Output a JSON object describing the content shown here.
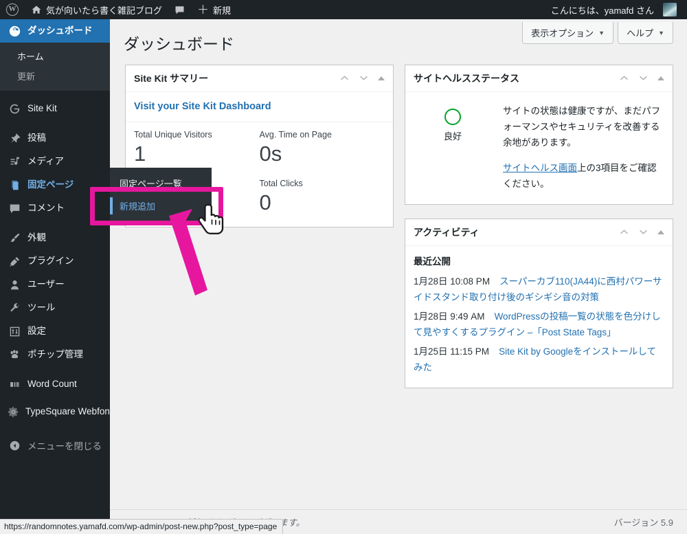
{
  "adminbar": {
    "wp_logo_label": "W",
    "site_name": "気が向いたら書く雑記ブログ",
    "comments_icon": "comment-bubble-icon",
    "new_label": "新規",
    "greeting": "こんにちは、yamafd さん"
  },
  "sidebar": {
    "items": [
      {
        "label": "ダッシュボード",
        "icon": "dashboard-icon",
        "state": "current"
      },
      {
        "label": "Site Kit",
        "icon": "google-g-icon",
        "state": "normal"
      },
      {
        "label": "投稿",
        "icon": "pin-icon",
        "state": "normal"
      },
      {
        "label": "メディア",
        "icon": "media-icon",
        "state": "normal"
      },
      {
        "label": "固定ページ",
        "icon": "pages-icon",
        "state": "open-parent"
      },
      {
        "label": "コメント",
        "icon": "comment-icon",
        "state": "normal"
      },
      {
        "label": "外観",
        "icon": "appearance-brush-icon",
        "state": "normal"
      },
      {
        "label": "プラグイン",
        "icon": "plugin-icon",
        "state": "normal"
      },
      {
        "label": "ユーザー",
        "icon": "user-icon",
        "state": "normal"
      },
      {
        "label": "ツール",
        "icon": "wrench-icon",
        "state": "normal"
      },
      {
        "label": "設定",
        "icon": "settings-sliders-icon",
        "state": "normal"
      },
      {
        "label": "ポチップ管理",
        "icon": "paw-icon",
        "state": "normal"
      },
      {
        "label": "Word Count",
        "icon": "wordcount-icon",
        "state": "normal"
      },
      {
        "label": "TypeSquare Webfonts",
        "icon": "gear-icon",
        "state": "normal"
      }
    ],
    "dashboard_submenu": [
      {
        "label": "ホーム",
        "dim": false
      },
      {
        "label": "更新",
        "dim": true
      }
    ],
    "collapse_label": "メニューを閉じる",
    "collapse_icon": "collapse-arrow-icon"
  },
  "pages_flyout": {
    "items": [
      {
        "label": "固定ページ一覧",
        "active": false
      },
      {
        "label": "新規追加",
        "active": true
      }
    ]
  },
  "screen_meta": {
    "screen_options_label": "表示オプション",
    "help_label": "ヘルプ",
    "caret_icon": "chevron-down-icon"
  },
  "page": {
    "title": "ダッシュボード"
  },
  "widgets": {
    "sitekit": {
      "title": "Site Kit サマリー",
      "dashboard_link": "Visit your Site Kit Dashboard",
      "stats": [
        {
          "label": "Total Unique Visitors",
          "value": "1"
        },
        {
          "label": "Avg. Time on Page",
          "value": "0s"
        },
        {
          "label": "",
          "value": ""
        },
        {
          "label": "Total Clicks",
          "value": "0"
        }
      ]
    },
    "health": {
      "title": "サイトヘルスステータス",
      "status_label": "良好",
      "status_color": "#00a32a",
      "paragraph": "サイトの状態は健康ですが、まだパフォーマンスやセキュリティを改善する余地があります。",
      "link_text": "サイトヘルス画面",
      "link_suffix": "上の3項目をご確認ください。"
    },
    "activity": {
      "title": "アクティビティ",
      "subheading": "最近公開",
      "items": [
        {
          "date": "1月28日 10:08 PM",
          "title": "スーパーカブ110(JA44)に西村パワーサイドスタンド取り付け後のギシギシ音の対策"
        },
        {
          "date": "1月28日 9:49 AM",
          "title": "WordPressの投稿一覧の状態を色分けして見やすくするプラグイン –「Post State Tags」"
        },
        {
          "date": "1月25日 11:15 PM",
          "title": "Site Kit by Googleをインストールしてみた"
        }
      ]
    }
  },
  "footer": {
    "link_text": "WordPress",
    "thanks_text": " のご利用ありがとうございます。",
    "version": "バージョン 5.9"
  },
  "statusbar": {
    "url": "https://randomnotes.yamafd.com/wp-admin/post-new.php?post_type=page"
  },
  "annotations": {
    "highlight_color": "#e6179e",
    "arrow_icon": "magenta-arrow-icon",
    "cursor_icon": "hand-pointer-cursor-icon"
  }
}
